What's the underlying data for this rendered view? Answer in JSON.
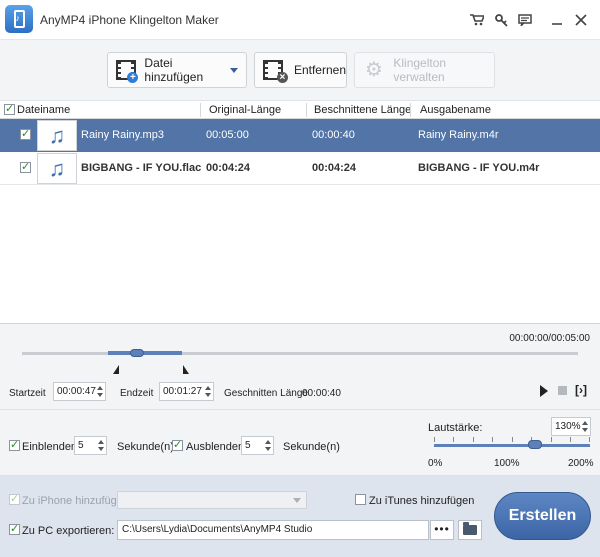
{
  "window": {
    "title": "AnyMP4 iPhone Klingelton Maker",
    "icons": [
      "cart-icon",
      "key-icon",
      "feedback-icon",
      "minimize-icon",
      "close-icon"
    ]
  },
  "toolbar": {
    "add_file_label": "Datei hinzufügen",
    "remove_label": "Entfernen",
    "manage_label": "Klingelton verwalten"
  },
  "table": {
    "columns": {
      "filename": "Dateiname",
      "original": "Original-Länge",
      "trimmed": "Beschnittene Länge",
      "output": "Ausgabename"
    },
    "rows": [
      {
        "name": "Rainy Rainy.mp3",
        "original": "00:05:00",
        "trimmed": "00:00:40",
        "output": "Rainy Rainy.m4r",
        "selected": true,
        "checked": true
      },
      {
        "name": "BIGBANG - IF YOU.flac",
        "original": "00:04:24",
        "trimmed": "00:04:24",
        "output": "BIGBANG - IF YOU.m4r",
        "selected": false,
        "checked": true
      }
    ]
  },
  "timeline": {
    "position": "00:00:00/00:05:00",
    "start_label": "Startzeit",
    "start_value": "00:00:47",
    "end_label": "Endzeit",
    "end_value": "00:01:27",
    "cut_length_label": "Geschnitten Länge",
    "cut_length_value": "00:00:40"
  },
  "fade": {
    "fade_in_label": "Einblenden",
    "fade_in_value": "5",
    "fade_in_unit": "Sekunde(n)",
    "fade_out_label": "Ausblenden",
    "fade_out_value": "5",
    "fade_out_unit": "Sekunde(n)",
    "volume_label": "Lautstärke:",
    "volume_value": "130%",
    "volume_level_percent": 130,
    "scale": [
      "0%",
      "100%",
      "200%"
    ]
  },
  "bottom": {
    "iphone_label": "Zu iPhone hinzufügen:",
    "itunes_label": "Zu iTunes hinzufügen",
    "pc_label": "Zu PC exportieren:",
    "pc_path": "C:\\Users\\Lydia\\Documents\\AnyMP4 Studio",
    "browse_dots": "•••",
    "create_label": "Erstellen"
  },
  "colors": {
    "accent": "#5274a6",
    "create_button": "#4a74b5"
  }
}
